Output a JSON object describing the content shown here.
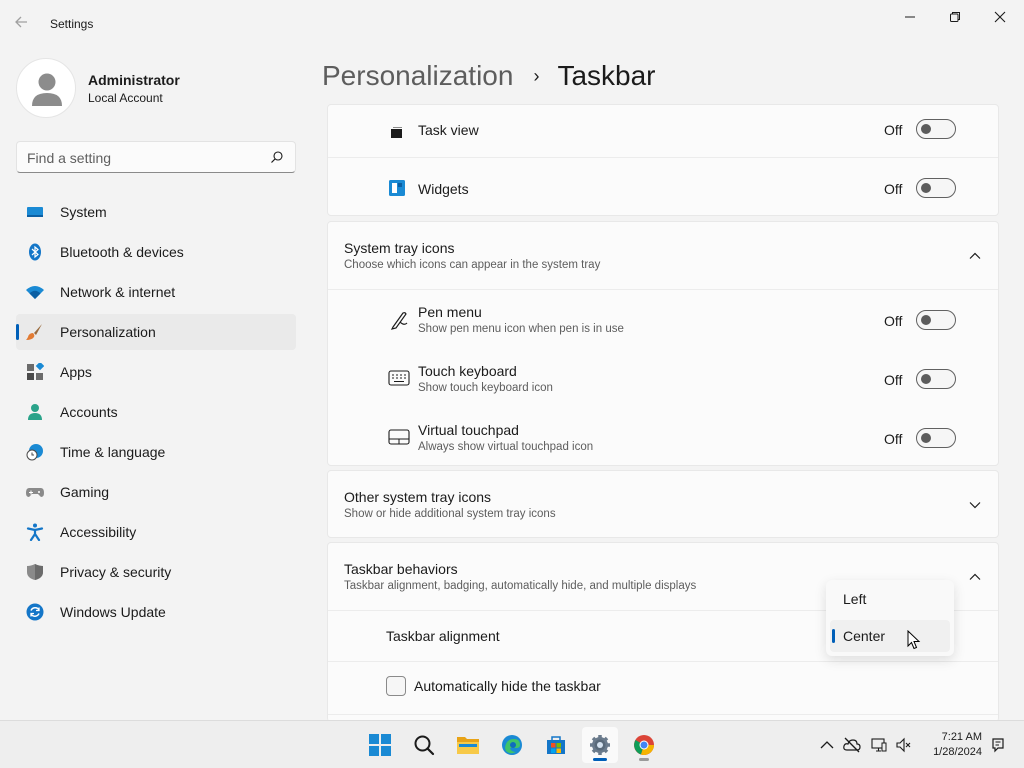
{
  "window": {
    "title": "Settings"
  },
  "user": {
    "name": "Administrator",
    "account_type": "Local Account"
  },
  "search": {
    "placeholder": "Find a setting"
  },
  "sidebar": {
    "items": [
      {
        "label": "System",
        "icon": "monitor-icon"
      },
      {
        "label": "Bluetooth & devices",
        "icon": "bluetooth-icon"
      },
      {
        "label": "Network & internet",
        "icon": "wifi-icon"
      },
      {
        "label": "Personalization",
        "icon": "brush-icon",
        "selected": true
      },
      {
        "label": "Apps",
        "icon": "apps-icon"
      },
      {
        "label": "Accounts",
        "icon": "person-icon"
      },
      {
        "label": "Time & language",
        "icon": "globe-clock-icon"
      },
      {
        "label": "Gaming",
        "icon": "gamepad-icon"
      },
      {
        "label": "Accessibility",
        "icon": "accessibility-icon"
      },
      {
        "label": "Privacy & security",
        "icon": "shield-icon"
      },
      {
        "label": "Windows Update",
        "icon": "sync-icon"
      }
    ]
  },
  "header": {
    "parent": "Personalization",
    "separator": "›",
    "current": "Taskbar"
  },
  "taskbar_items": {
    "task_view": {
      "label": "Task view",
      "state": "Off"
    },
    "widgets": {
      "label": "Widgets",
      "state": "Off"
    }
  },
  "system_tray": {
    "title": "System tray icons",
    "subtitle": "Choose which icons can appear in the system tray",
    "items": {
      "pen_menu": {
        "label": "Pen menu",
        "sub": "Show pen menu icon when pen is in use",
        "state": "Off"
      },
      "touch_keyboard": {
        "label": "Touch keyboard",
        "sub": "Show touch keyboard icon",
        "state": "Off"
      },
      "virtual_touchpad": {
        "label": "Virtual touchpad",
        "sub": "Always show virtual touchpad icon",
        "state": "Off"
      }
    }
  },
  "other_tray": {
    "title": "Other system tray icons",
    "subtitle": "Show or hide additional system tray icons"
  },
  "behaviors": {
    "title": "Taskbar behaviors",
    "subtitle": "Taskbar alignment, badging, automatically hide, and multiple displays",
    "alignment_label": "Taskbar alignment",
    "alignment_options": [
      "Left",
      "Center"
    ],
    "alignment_selected": "Center",
    "auto_hide_label": "Automatically hide the taskbar",
    "auto_hide_checked": false
  },
  "clock": {
    "time": "7:21 AM",
    "date": "1/28/2024"
  },
  "colors": {
    "accent": "#005fb8",
    "background": "#f3f3f3",
    "card": "#fbfbfb"
  }
}
